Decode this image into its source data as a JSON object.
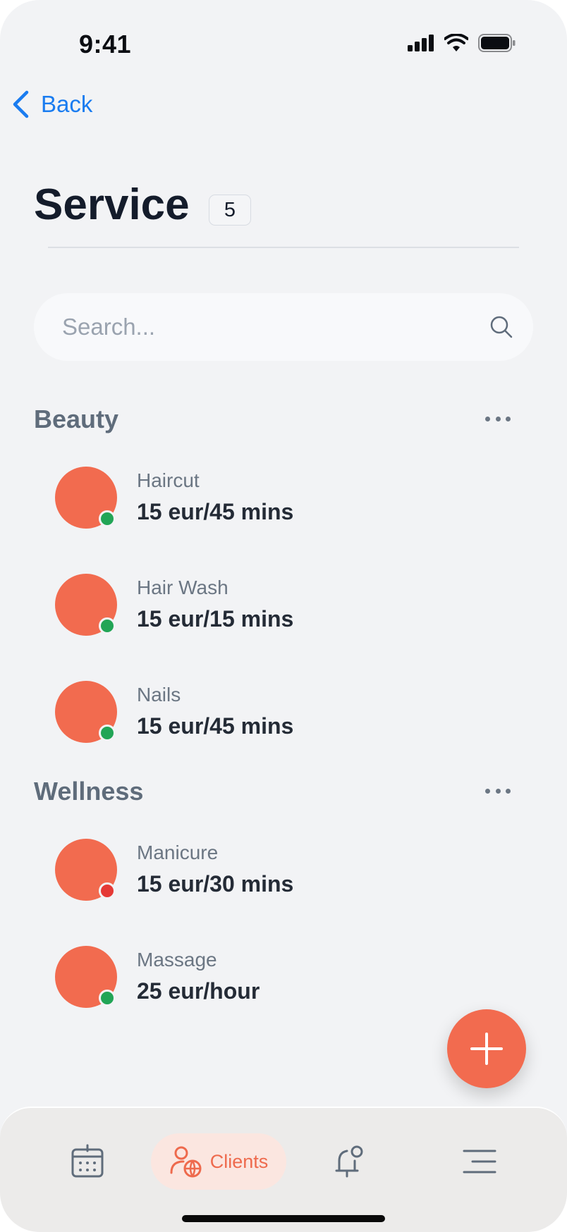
{
  "status_bar": {
    "time": "9:41"
  },
  "nav": {
    "back_label": "Back"
  },
  "header": {
    "title": "Service",
    "count": "5"
  },
  "search": {
    "placeholder": "Search..."
  },
  "sections": [
    {
      "title": "Beauty",
      "items": [
        {
          "name": "Haircut",
          "price": "15 eur/45 mins",
          "status": "active",
          "status_color": "#22a556"
        },
        {
          "name": "Hair Wash",
          "price": "15 eur/15 mins",
          "status": "active",
          "status_color": "#22a556"
        },
        {
          "name": "Nails",
          "price": "15 eur/45 mins",
          "status": "active",
          "status_color": "#22a556"
        }
      ]
    },
    {
      "title": "Wellness",
      "items": [
        {
          "name": "Manicure",
          "price": "15 eur/30 mins",
          "status": "inactive",
          "status_color": "#e53935"
        },
        {
          "name": "Massage",
          "price": "25 eur/hour",
          "status": "active",
          "status_color": "#22a556"
        }
      ]
    }
  ],
  "fab": {
    "icon": "plus-icon"
  },
  "bottom_nav": {
    "items": [
      {
        "icon": "calendar-icon"
      },
      {
        "icon": "clients-icon",
        "label": "Clients",
        "active": true
      },
      {
        "icon": "notification-bell-icon"
      },
      {
        "icon": "menu-icon"
      }
    ]
  },
  "colors": {
    "accent": "#f26b4f",
    "link": "#1a7cf0",
    "background": "#f2f3f5",
    "active_status": "#22a556",
    "inactive_status": "#e53935"
  }
}
